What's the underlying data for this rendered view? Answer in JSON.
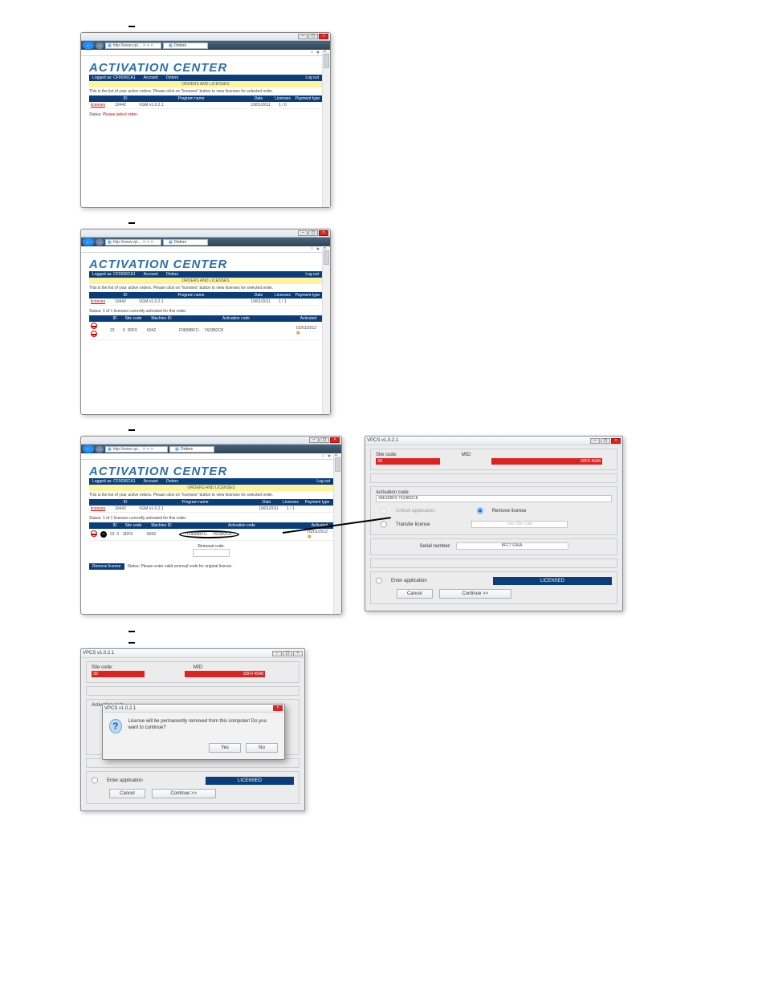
{
  "browser": {
    "url": "http://www.vpi... ",
    "tab": "Orders",
    "back": "←",
    "fwd": "→"
  },
  "activationCenter": {
    "logo": "ACTIVATION CENTER",
    "nav": {
      "logged": "Logged as: CF0036CA1",
      "account": "Account",
      "orders": "Orders",
      "logout": "Log out"
    },
    "banner": "ORDERS AND LICENSES",
    "hint": "This is the list of your active orders. Please click on \"licenses\" button to view licenses for selected order.",
    "tableHeaders": {
      "blank": "",
      "id": "ID",
      "program": "Program name",
      "date": "Date",
      "licenses": "Licenses",
      "payment": "Payment type"
    },
    "orderRow": {
      "link": "licenses",
      "id": "10442",
      "program": "VGM v1.0.2.1",
      "date": "19/01/2011",
      "licenses": "1 / 0",
      "payment": ""
    },
    "status1": "Status:",
    "status1_red": "Please select order.",
    "orderRow2": {
      "licenses": "1 / 1"
    },
    "status2line": "Status: 1 of 1 licenses currently activated for this order.",
    "licHeaders": {
      "blank": "",
      "blank2": "",
      "id": "ID",
      "site": "Site code",
      "machine": "Machine ID",
      "actcode": "Activation code",
      "activated": "Activated"
    },
    "licRow": {
      "id": "23",
      "unk": "0",
      "site": "3DF0",
      "machine": "6042",
      "code": "F0839BFC-",
      "code2": "7423B2C8",
      "date": "01/01/2012"
    },
    "removalLabel": "Removal code:",
    "removeBtn": "Remove license",
    "removeStatus": "Status: Please enter valid removal code for original license."
  },
  "vpcs": {
    "title": "VPCS v1.0.2.1",
    "siteLabel": "Site code:",
    "midLabel": "MID:",
    "siteVal": "3D",
    "midVal": "3DF0                45A8",
    "actLabel": "Activation code",
    "actVal": "                    39E30BF9                    7423BDC8",
    "rUnlock": "Unlock application",
    "rRemove": "Remove license",
    "rTransfer": "Transfer license",
    "newSite": "new Site code",
    "serialLabel": "Serial number:",
    "serialVal": "8FC7                        F66A",
    "rEnter": "Enter application",
    "licensed": "LICENSED",
    "cancel": "Cancel",
    "cont": "Continue >>"
  },
  "popup": {
    "title": "VPCS v1.0.2.1",
    "msg": "License will be permanently removed from this computer! Do you want to continue?",
    "yes": "Yes",
    "no": "No"
  }
}
